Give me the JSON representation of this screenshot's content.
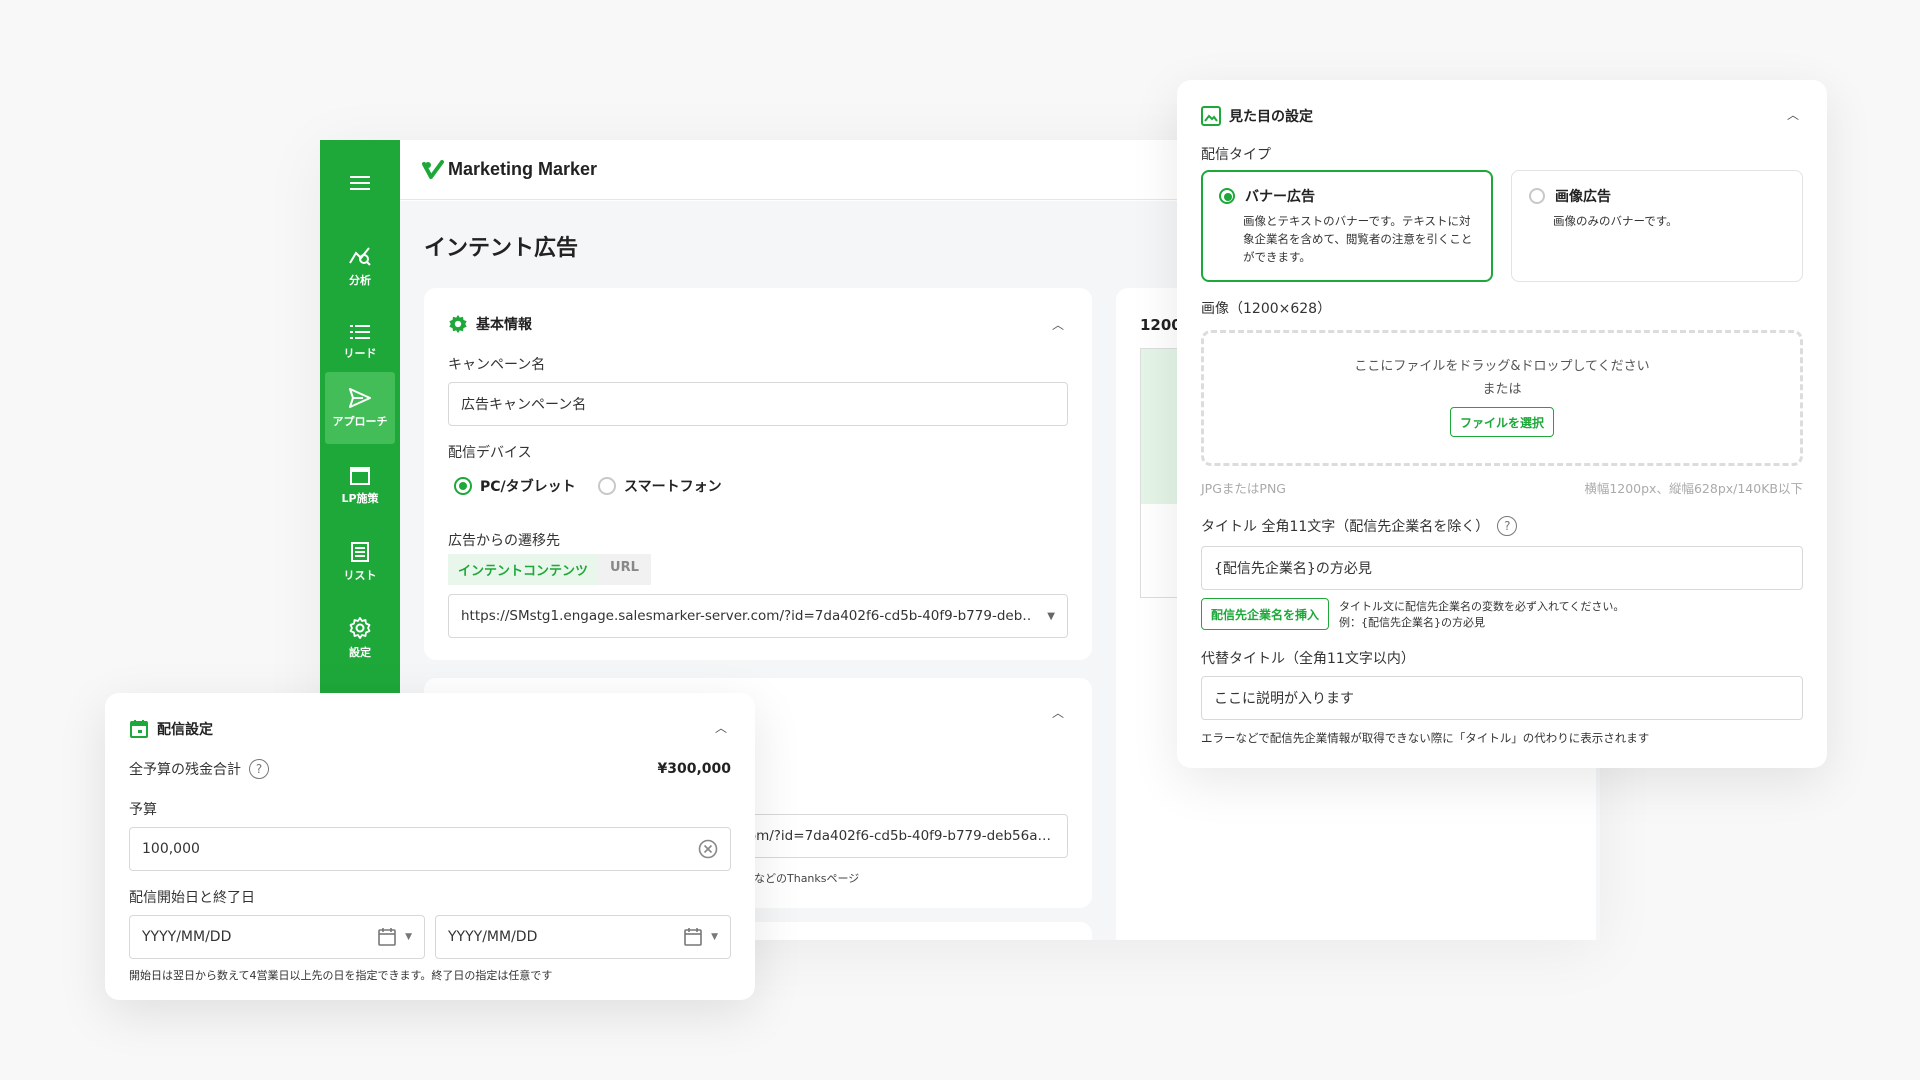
{
  "app": {
    "logo": "Marketing Marker",
    "page_title": "インテント広告",
    "sidebar": [
      {
        "label": "分析",
        "icon": "analytics-icon"
      },
      {
        "label": "リード",
        "icon": "list-icon"
      },
      {
        "label": "アプローチ",
        "icon": "send-icon"
      },
      {
        "label": "LP施策",
        "icon": "window-icon"
      },
      {
        "label": "リスト",
        "icon": "document-list-icon"
      },
      {
        "label": "設定",
        "icon": "gear-icon"
      }
    ]
  },
  "basic_info": {
    "title": "基本情報",
    "campaign_label": "キャンペーン名",
    "campaign_value": "広告キャンペーン名",
    "device_label": "配信デバイス",
    "device_options": [
      "PC/タブレット",
      "スマートフォン"
    ],
    "selected_device": "PC/タブレット",
    "destination_label": "広告からの遷移先",
    "destination_tabs": [
      "インテントコンテンツ",
      "URL"
    ],
    "destination_url": "https://SMstg1.engage.salesmarker-server.com/?id=7da402f6-cd5b-40f9-b779-deb…"
  },
  "second_card": {
    "url_value": "om/?id=7da402f6-cd5b-40f9-b779-deb56a…",
    "hint_text": "などのThanksページ"
  },
  "preview": {
    "label": "1200"
  },
  "visual_settings": {
    "title": "見た目の設定",
    "delivery_type_label": "配信タイプ",
    "options": [
      {
        "title": "バナー広告",
        "desc": "画像とテキストのバナーです。テキストに対象企業名を含めて、閲覧者の注意を引くことができます。",
        "selected": true
      },
      {
        "title": "画像広告",
        "desc": "画像のみのバナーです。",
        "selected": false
      }
    ],
    "image_label": "画像（1200×628）",
    "drop_text": "ここにファイルをドラッグ&ドロップしてください",
    "drop_or": "または",
    "select_file_button": "ファイルを選択",
    "format_hint": "JPGまたはPNG",
    "size_hint": "横幅1200px、縦幅628px/140KB以下",
    "title_label": "タイトル 全角11文字（配信先企業名を除く）",
    "title_value": "{配信先企業名}の方必見",
    "insert_button": "配信先企業名を挿入",
    "insert_hint_1": "タイトル文に配信先企業名の変数を必ず入れてください。",
    "insert_hint_2": "例：{配信先企業名}の方必見",
    "alt_title_label": "代替タイトル（全角11文字以内）",
    "alt_title_placeholder": "ここに説明が入ります",
    "alt_title_hint": "エラーなどで配信先企業情報が取得できない際に「タイトル」の代わりに表示されます"
  },
  "delivery_settings": {
    "title": "配信設定",
    "remaining_label": "全予算の残金合計",
    "remaining_value": "¥300,000",
    "budget_label": "予算",
    "budget_value": "100,000",
    "dates_label": "配信開始日と終了日",
    "start_placeholder": "YYYY/MM/DD",
    "end_placeholder": "YYYY/MM/DD",
    "dates_hint": "開始日は翌日から数えて4営業日以上先の日を指定できます。終了日の指定は任意です"
  },
  "colors": {
    "brand_green": "#1ea83a",
    "sidebar_active": "#43bd58"
  }
}
